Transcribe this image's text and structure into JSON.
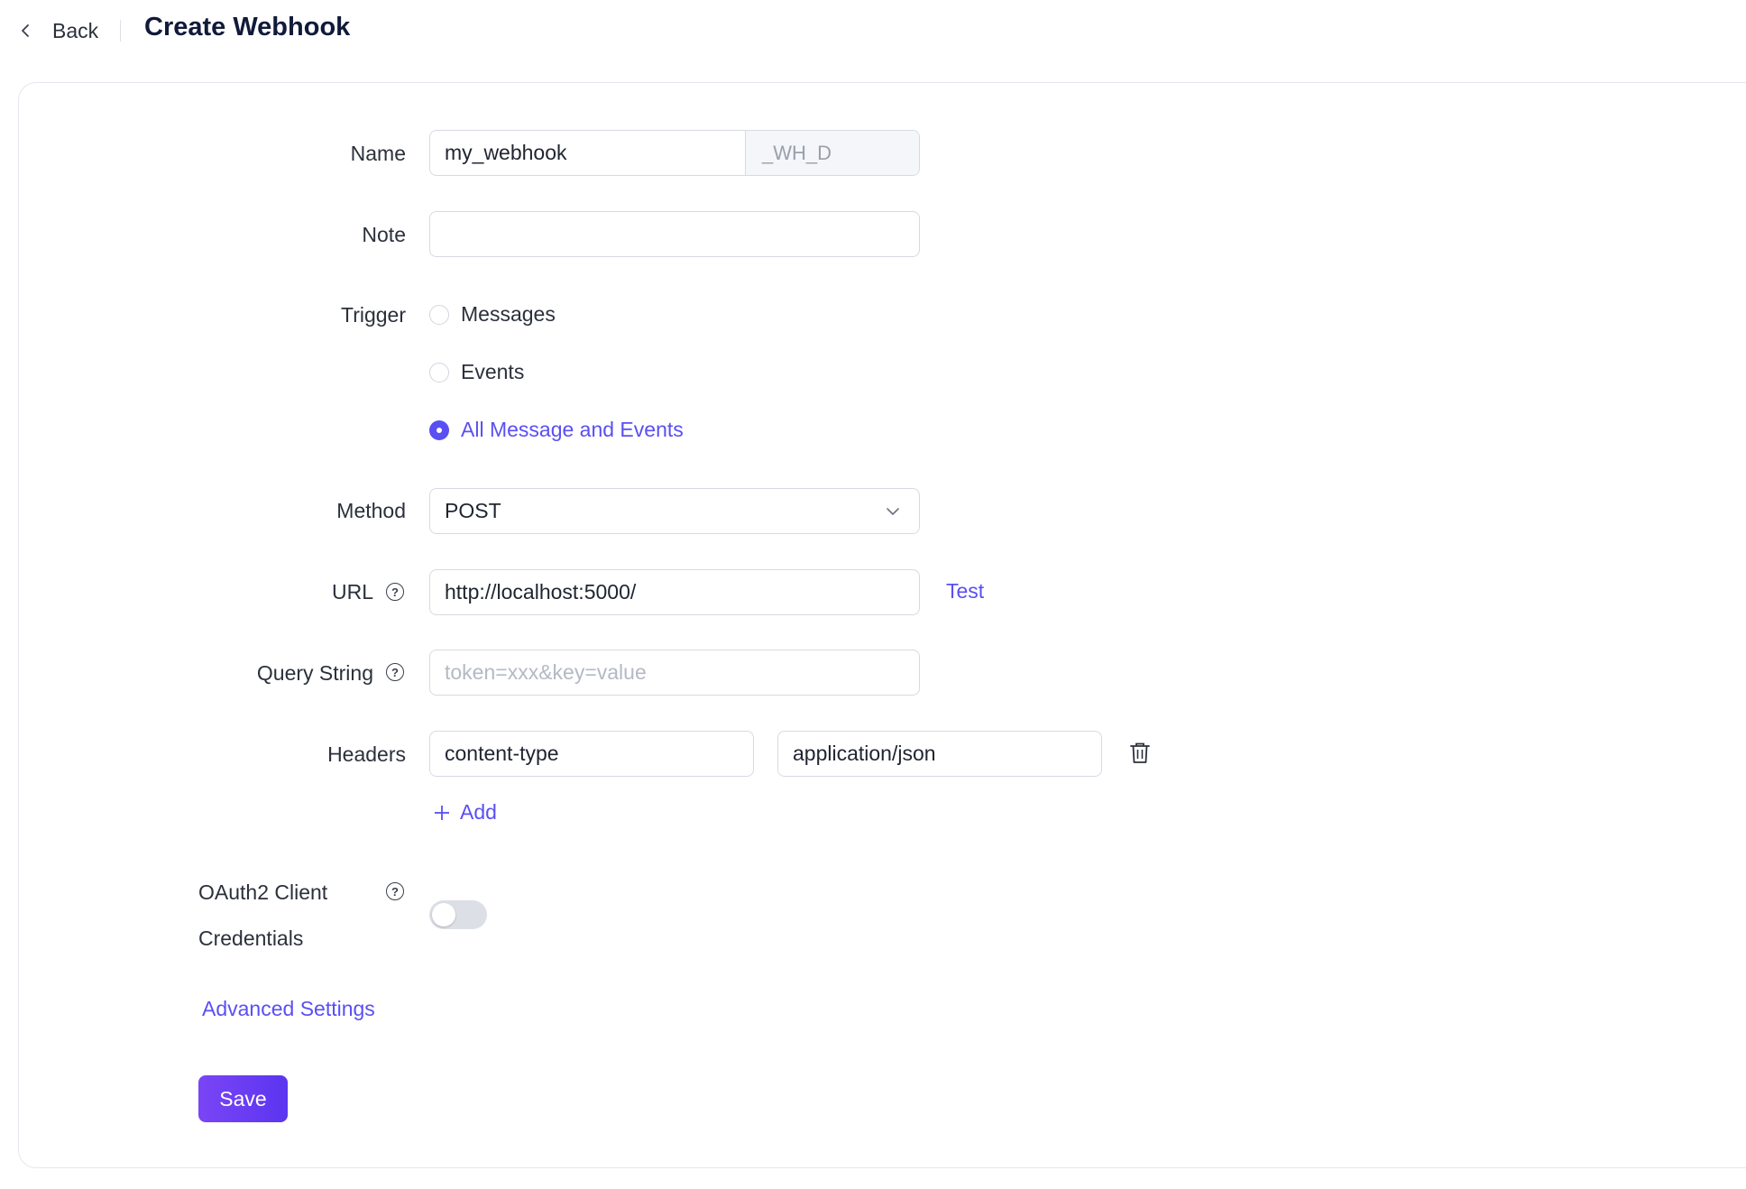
{
  "header": {
    "back_label": "Back",
    "title": "Create Webhook"
  },
  "form": {
    "name": {
      "label": "Name",
      "value": "my_webhook",
      "suffix": "_WH_D"
    },
    "note": {
      "label": "Note",
      "value": ""
    },
    "trigger": {
      "label": "Trigger",
      "options": [
        "Messages",
        "Events",
        "All Message and Events"
      ],
      "selected": "All Message and Events"
    },
    "method": {
      "label": "Method",
      "value": "POST"
    },
    "url": {
      "label": "URL",
      "value": "http://localhost:5000/",
      "test_label": "Test"
    },
    "query_string": {
      "label": "Query String",
      "value": "",
      "placeholder": "token=xxx&key=value"
    },
    "headers": {
      "label": "Headers",
      "rows": [
        {
          "key": "content-type",
          "value": "application/json"
        }
      ],
      "add_label": "Add"
    },
    "oauth2": {
      "label_line1": "OAuth2 Client",
      "label_line2": "Credentials",
      "enabled": false
    },
    "advanced_label": "Advanced Settings",
    "save_label": "Save"
  },
  "colors": {
    "accent": "#5a4ff3",
    "title": "#101a3a"
  },
  "icons": {
    "back": "chevron-left-icon",
    "help": "question-circle-icon",
    "dropdown": "chevron-down-icon",
    "delete": "trash-icon",
    "add": "plus-icon"
  }
}
